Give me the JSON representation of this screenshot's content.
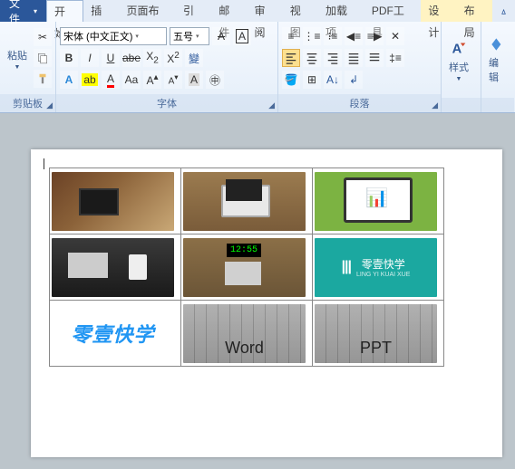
{
  "tabs": {
    "file": "文件",
    "home": "开始",
    "insert": "插入",
    "pagelayout": "页面布局",
    "references": "引用",
    "mailings": "邮件",
    "review": "审阅",
    "view": "视图",
    "addins": "加载项",
    "pdf": "PDF工具",
    "design": "设计",
    "layout": "布局"
  },
  "clipboard": {
    "label": "剪贴板",
    "paste": "粘贴"
  },
  "font": {
    "label": "字体",
    "family": "宋体 (中文正文)",
    "size": "五号"
  },
  "paragraph": {
    "label": "段落"
  },
  "styles": {
    "label": "样式"
  },
  "editing": {
    "label": "编辑"
  },
  "table": {
    "cells": {
      "brand_teal": "零壹快学",
      "brand_teal_sub": "LING YI KUAI XUE",
      "logo_text": "零壹快学",
      "word": "Word",
      "ppt": "PPT"
    }
  }
}
